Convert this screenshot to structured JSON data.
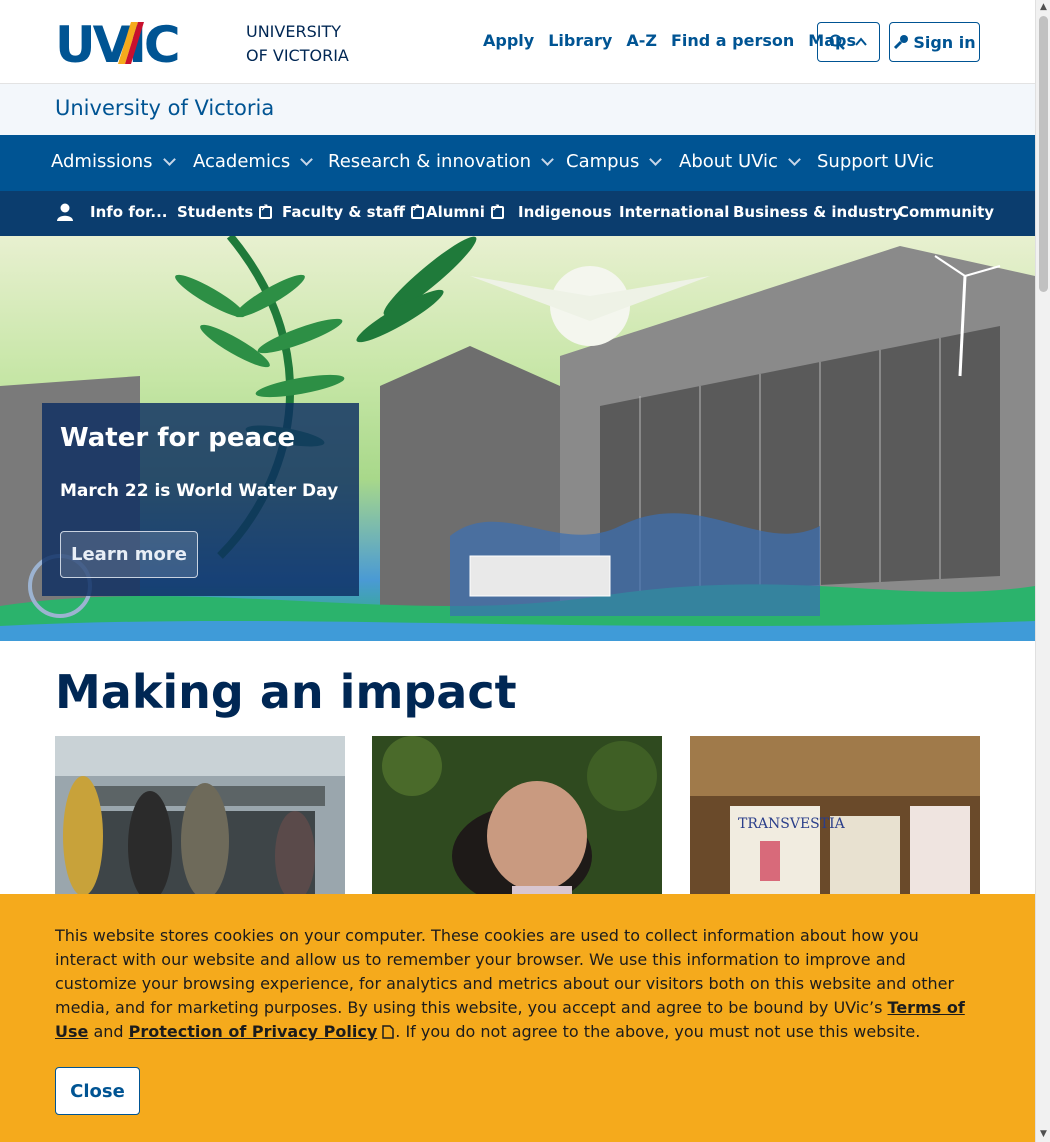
{
  "brand": {
    "logo_text": "UVIC",
    "university_line1": "UNIVERSITY",
    "university_line2": "OF VICTORIA"
  },
  "utility_nav": [
    "Apply",
    "Library",
    "A-Z",
    "Find a person",
    "Maps"
  ],
  "sign_in": "Sign in",
  "site_title": "University of Victoria",
  "main_nav": [
    "Admissions",
    "Academics",
    "Research & innovation",
    "Campus",
    "About UVic",
    "Support UVic"
  ],
  "audience_nav": {
    "info_label": "Info for...",
    "items": [
      "Students",
      "Faculty & staff",
      "Alumni",
      "Indigenous",
      "International",
      "Business & industry",
      "Community"
    ]
  },
  "hero": {
    "title": "Water for peace",
    "subtitle": "March 22 is World Water Day",
    "button": "Learn more"
  },
  "impact": {
    "title": "Making an impact"
  },
  "cookie": {
    "text_before": "This website stores cookies on your computer. These cookies are used to collect information about how you interact with our website and allow us to remember your browser. We use this information to improve and customize your browsing experience, for analytics and metrics about our visitors both on this website and other media, and for marketing purposes. By using this website, you accept and agree to be bound by UVic’s ",
    "terms_link": "Terms of Use",
    "and": " and ",
    "privacy_link": "Protection of Privacy Policy",
    "text_after": ". If you do not agree to the above, you must not use this website.",
    "close": "Close"
  },
  "colors": {
    "primary": "#005493",
    "dark_blue": "#002754",
    "audience_bar": "#0b3d6e",
    "cookie_bg": "#f5aa1c"
  }
}
